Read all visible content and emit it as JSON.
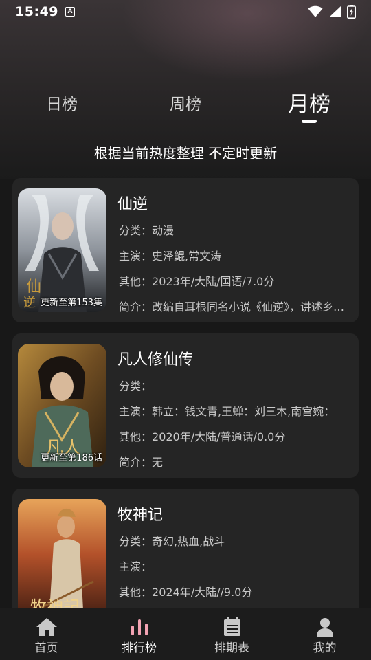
{
  "status": {
    "time": "15:49",
    "notification_letter": "A"
  },
  "tabs": [
    {
      "label": "日榜",
      "active": false
    },
    {
      "label": "周榜",
      "active": false
    },
    {
      "label": "月榜",
      "active": true
    }
  ],
  "subtitle": "根据当前热度整理 不定时更新",
  "labels": {
    "category": "分类：",
    "cast": "主演：",
    "other": "其他：",
    "intro": "简介："
  },
  "items": [
    {
      "title": "仙逆",
      "badge": "更新至第153集",
      "category": "动漫",
      "cast": "史泽鲲,常文涛",
      "other": "2023年/大陆/国语/7.0分",
      "intro": "改编自耳根同名小说《仙逆》，讲述乡村平凡少年王林"
    },
    {
      "title": "凡人修仙传",
      "badge": "更新至第186话",
      "category": "",
      "cast": "韩立：钱文青,王蝉：刘三木,南宫婉：",
      "other": "2020年/大陆/普通话/0.0分",
      "intro": "无"
    },
    {
      "title": "牧神记",
      "badge": "",
      "category": "奇幻,热血,战斗",
      "cast": "",
      "other": "2024年/大陆//9.0分",
      "intro": ""
    }
  ],
  "bottom_nav": [
    {
      "label": "首页",
      "icon": "home-icon",
      "active": false
    },
    {
      "label": "排行榜",
      "icon": "ranking-icon",
      "active": true
    },
    {
      "label": "排期表",
      "icon": "calendar-icon",
      "active": false
    },
    {
      "label": "我的",
      "icon": "person-icon",
      "active": false
    }
  ],
  "colors": {
    "background": "#181818",
    "card": "#252525",
    "accent_pink": "#f3a3b3"
  }
}
